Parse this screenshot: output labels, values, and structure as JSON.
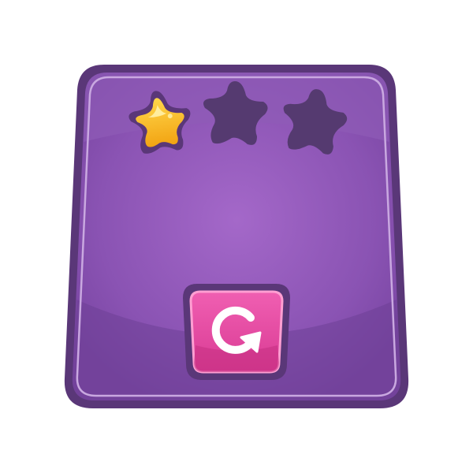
{
  "level_panel": {
    "stars": {
      "earned": 1,
      "total": 3
    },
    "colors": {
      "panel_outline": "#5a3778",
      "panel_fill": "#9d66c4",
      "panel_fill_edge": "#7c4aa6",
      "panel_inner_border": "#c9a8e0",
      "star_earned": "#f7be1f",
      "star_earned_outline": "#5a3778",
      "star_empty": "#553a70",
      "replay_button_fill": "#e6449f",
      "replay_button_border": "#ff9fd2",
      "replay_button_outline": "#5a3778",
      "replay_icon": "#ffffff"
    },
    "replay_button": {
      "icon": "replay-icon"
    }
  }
}
